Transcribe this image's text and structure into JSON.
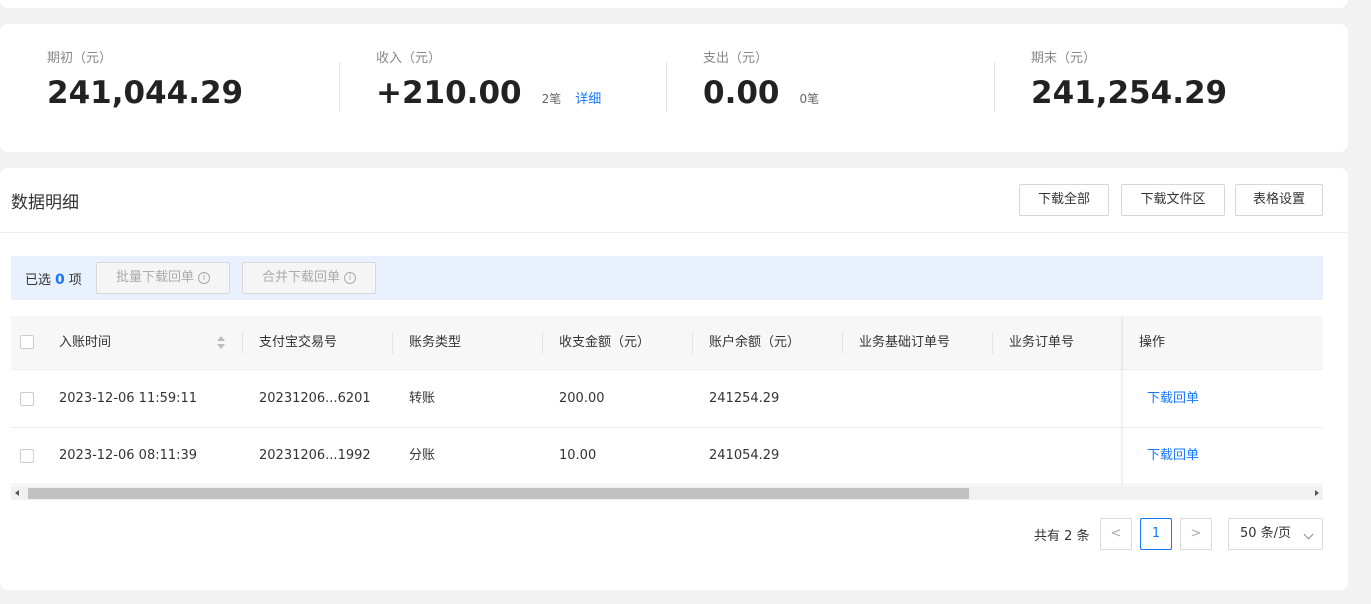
{
  "summary": {
    "opening": {
      "label": "期初（元）",
      "value": "241,044.29"
    },
    "income": {
      "label": "收入（元）",
      "value": "+210.00",
      "count": "2笔",
      "detail_link": "详细"
    },
    "expense": {
      "label": "支出（元）",
      "value": "0.00",
      "count": "0笔"
    },
    "closing": {
      "label": "期末（元）",
      "value": "241,254.29"
    }
  },
  "detail": {
    "title": "数据明细",
    "buttons": {
      "download_all": "下载全部",
      "download_area": "下载文件区",
      "table_settings": "表格设置"
    }
  },
  "selection": {
    "prefix": "已选",
    "count": "0",
    "suffix": "项",
    "batch_download": "批量下载回单",
    "merge_download": "合并下载回单",
    "info_glyph": "i"
  },
  "table": {
    "columns": [
      "入账时间",
      "支付宝交易号",
      "账务类型",
      "收支金额（元）",
      "账户余额（元）",
      "业务基础订单号",
      "业务订单号",
      "操作"
    ],
    "rows": [
      {
        "time": "2023-12-06 11:59:11",
        "trade_no": "20231206...6201",
        "type": "转账",
        "amount": "200.00",
        "balance": "241254.29",
        "base_order": "",
        "order": "",
        "action": "下载回单"
      },
      {
        "time": "2023-12-06 08:11:39",
        "trade_no": "20231206...1992",
        "type": "分账",
        "amount": "10.00",
        "balance": "241054.29",
        "base_order": "",
        "order": "",
        "action": "下载回单"
      }
    ]
  },
  "pagination": {
    "total": "共有 2 条",
    "prev": "<",
    "current": "1",
    "next": ">",
    "page_size": "50 条/页"
  },
  "colors": {
    "accent": "#1677ff",
    "selection_bar": "#eaf1fe"
  }
}
